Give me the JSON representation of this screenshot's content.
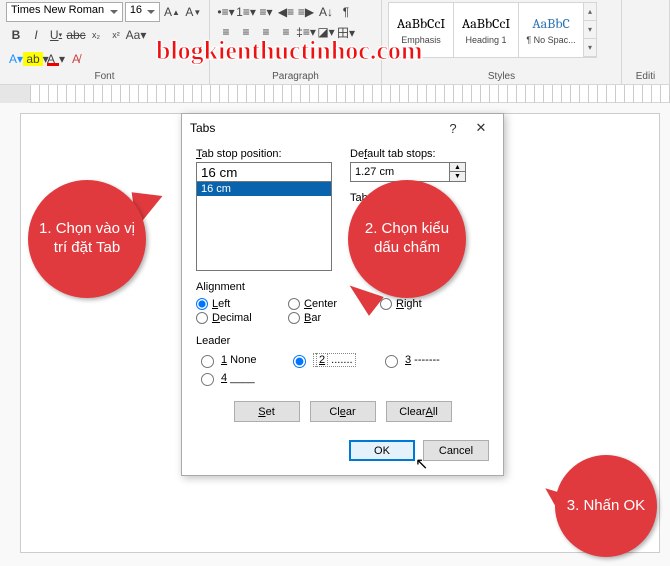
{
  "ribbon": {
    "font_name": "Times New Roman",
    "font_size": "16",
    "groups": {
      "font": "Font",
      "paragraph": "Paragraph",
      "styles": "Styles",
      "editing": "Editi"
    },
    "styles": [
      {
        "preview": "AaBbCcI",
        "caption": "Emphasis"
      },
      {
        "preview": "AaBbCcI",
        "caption": "Heading 1"
      },
      {
        "preview": "AaBbC",
        "caption": "¶ No Spac..."
      }
    ]
  },
  "watermark": "blogkienthuctinhoc.com",
  "dialog": {
    "title": "Tabs",
    "tab_stop_label": "Tab stop position:",
    "tab_stop_value": "16 cm",
    "list_item": "16 cm",
    "default_label": "Default tab stops:",
    "default_value": "1.27 cm",
    "tabs_cleared_label": "Tab",
    "alignment": {
      "title": "Alignment",
      "left": "Left",
      "center": "Center",
      "right": "Right",
      "decimal": "Decimal",
      "bar": "Bar"
    },
    "leader": {
      "title": "Leader",
      "opt1": "1 None",
      "opt2": "2 .......",
      "opt3": "3 -------",
      "opt4": "4 ___"
    },
    "buttons": {
      "set": "Set",
      "clear": "Clear",
      "clear_all": "Clear All",
      "ok": "OK",
      "cancel": "Cancel"
    }
  },
  "callouts": {
    "c1": "1. Chọn vào vị trí đặt Tab",
    "c2": "2. Chọn kiểu dấu chấm",
    "c3": "3. Nhấn OK"
  }
}
